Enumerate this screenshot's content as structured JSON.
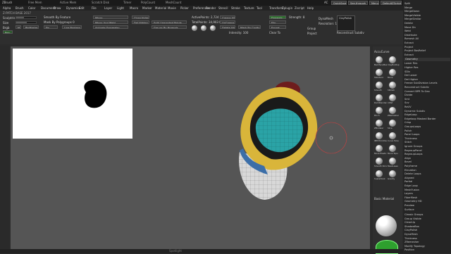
{
  "title": {
    "app": "ZBrush",
    "left_items": [
      "ZBrush",
      "Go Live Now",
      "Free Mem",
      "Active Mem",
      "Scratch Disk",
      "Timer",
      "PolyCount",
      "MeshCount"
    ],
    "right_items": [
      "AC",
      "QuickSave",
      "See-through",
      "Menus",
      "DefaultZScript"
    ]
  },
  "menu": [
    "Alpha",
    "Brush",
    "Color",
    "Document",
    "Draw",
    "Dynamics",
    "Edit",
    "File",
    "Layer",
    "Light",
    "Macro",
    "Marker",
    "Material",
    "Movie",
    "Picker",
    "Preferences",
    "Render",
    "Stencil",
    "Stroke",
    "Texture",
    "Tool",
    "Transform",
    "Zplugin",
    "Zscript",
    "Help"
  ],
  "toolbar": {
    "project_name": "Z-PATCH BASE 2017",
    "sculptris_label": "Sculptris",
    "size_label": "Size",
    "brgb_label": "Brgb",
    "m_label": "M",
    "pinmaster_label": "PinMaster",
    "poly_label": "Poly",
    "remesh_label": "Remesh",
    "brush_label": "Brush Shortcut",
    "smooth_label": "Smooth By Feature",
    "mask_label": "Mask By Polygroups 0",
    "fix_label": "Fix",
    "live_boolean": "Live Boolean",
    "mirror_label": "Mirror",
    "mirror_weld": "Mirror And Weld",
    "close_holes": "Close Holes",
    "del_hidden": "Del Hidden",
    "split_unmasked": "Split Unmasked Points",
    "activate_symmetry": "Activate Symmetry",
    "groups_by_normals": "Groups By Normals",
    "active_points": "ActivePoints: 2,724",
    "total_points": "TotalPoints: 34,903 Mil",
    "delete_hidden": "Delete Hidden",
    "crease_all": "Crease All",
    "uncrease_all": "UnCrease All",
    "intensity": "Intensity: 100",
    "mask_by_cavity": "Mask By Cavity",
    "clear_to": "Clear To",
    "dynamic": "Dynamic",
    "flip": "Flip",
    "export": "Export",
    "stroke_label": "Strength: 8",
    "group_label": "Group",
    "project_label": "Project",
    "dynamesh_label": "DynaMesh",
    "resolution": "Resolution: 128",
    "claypolish": "ClayPolish",
    "reconstruct": "Reconstruct Subdiv"
  },
  "shelf": {
    "header": "AccuCurve",
    "items": [
      "BackfaceMask",
      "ClayBuildup",
      "Standard",
      "Move",
      "Smooth",
      "hPolish",
      "DamStandard",
      "Inflat",
      "Pinch",
      "ZRemesher",
      "ZModeler",
      "Slice",
      "IMM Primitives",
      "Curve Tube",
      "Move Elastic",
      "Move Topo",
      "Smooth Stronger",
      "MaskLasso",
      "SnakeHook",
      "Gravity"
    ],
    "material_label": "Basic Material",
    "color_label": "Color"
  },
  "rpanel": {
    "top": [
      "Split",
      "Merge",
      "MergeDown",
      "MergeVisible",
      "MergeSimilar",
      "Delete",
      "Move Dn",
      "Weld",
      "Distribute",
      "Remesh All",
      "Extract",
      "Project",
      "Project BasRelief",
      "Extract"
    ],
    "geometry_head": "Geometry",
    "geometry_items": [
      "Lower Res",
      "Higher Res",
      "SDiv",
      "Del Lower",
      "Del Higher",
      "Freeze SubDivision Levels",
      "Reconstruct Subdiv",
      "Convert BPR To Geo",
      "Divide",
      "Smt",
      "Suv",
      "ReUV",
      "Dynamic Subdiv",
      "EdgeLoop",
      "Edgeloop Masked Border",
      "Crisp",
      "GroupsLoops",
      "Polish",
      "Panel Loops",
      "Thickness",
      "Stitch",
      "Ignore Groups",
      "RegroupPanel",
      "RegroupLoops",
      "Align",
      "Bevel",
      "Polyframe",
      "Elevation",
      "Delete Loops",
      "Aligned",
      "Partial",
      "Edge Loop",
      "MeshFusion",
      "Layers",
      "FiberMesh",
      "Geometry HD",
      "Preview",
      "Surface",
      "Deformation",
      "Masking",
      "Visibility",
      "Polygroups",
      "Contact",
      "Morph Target",
      "Polypaint",
      "UV Map",
      "Texture Map",
      "Displacement",
      "Normal Map",
      "Vector Displacement",
      "Unified Skin",
      "Initialize",
      "Import",
      "Export"
    ],
    "bottom": [
      "Classic Groups",
      "Group Visible",
      "CleanUp",
      "ShadowBox",
      "ClayPolish",
      "DynaMesh",
      "Thickness",
      "ZRemesher",
      "Modify Topology",
      "Position",
      "Size",
      "MeshIntegrity"
    ]
  },
  "model": {
    "colors": {
      "yellow": "#d9b53a",
      "teal": "#2aa3a6",
      "grid": "#cfcfcf",
      "blue": "#3b6ea8",
      "dark": "#1a1a1a",
      "red": "#7a1f1f",
      "brush": "#c94040"
    }
  },
  "bottom_bar": {
    "spotlight": "Spotlight"
  }
}
